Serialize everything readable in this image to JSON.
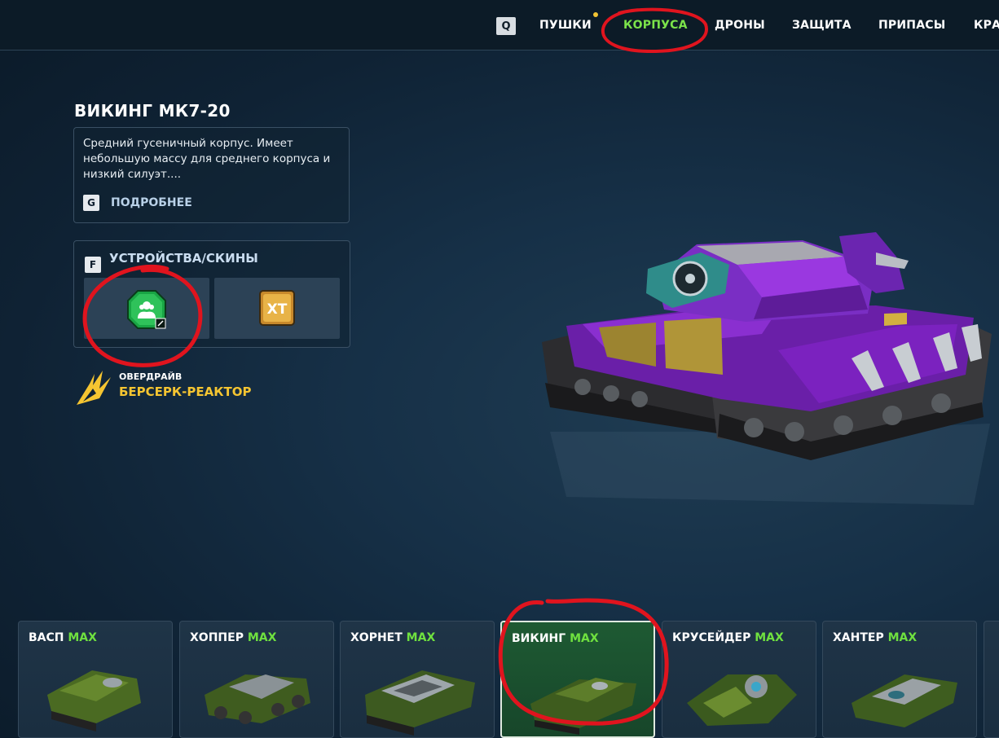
{
  "nav": {
    "search_key": "Q",
    "items": [
      {
        "label": "ПУШКИ",
        "active": false
      },
      {
        "label": "КОРПУСА",
        "active": true
      },
      {
        "label": "ДРОНЫ",
        "active": false
      },
      {
        "label": "ЗАЩИТА",
        "active": false
      },
      {
        "label": "ПРИПАСЫ",
        "active": false
      },
      {
        "label": "КРА",
        "active": false
      }
    ]
  },
  "hull": {
    "title": "ВИКИНГ МК7-20",
    "description": "Средний гусеничный корпус. Имеет небольшую массу для среднего корпуса и низкий силуэт....",
    "more_key": "G",
    "more_label": "ПОДРОБНЕЕ"
  },
  "devices": {
    "key": "F",
    "title": "УСТРОЙСТВА/СКИНЫ",
    "slot_icons": [
      "augment-icon",
      "xt-skin-icon"
    ]
  },
  "overdrive": {
    "label": "ОВЕРДРАЙВ",
    "name": "БЕРСЕРК-РЕАКТОР"
  },
  "hulls": [
    {
      "name": "ВАСП",
      "level": "MAX",
      "selected": false
    },
    {
      "name": "ХОППЕР",
      "level": "MAX",
      "selected": false
    },
    {
      "name": "ХОРНЕТ",
      "level": "MAX",
      "selected": false
    },
    {
      "name": "ВИКИНГ",
      "level": "MAX",
      "selected": true
    },
    {
      "name": "КРУСЕЙДЕР",
      "level": "MAX",
      "selected": false
    },
    {
      "name": "ХАНТЕР",
      "level": "MAX",
      "selected": false
    }
  ],
  "colors": {
    "accent_green": "#7be24a",
    "overdrive_yellow": "#f5c531",
    "annotation_red": "#e0141e",
    "selected_card": "#1e5a33"
  }
}
